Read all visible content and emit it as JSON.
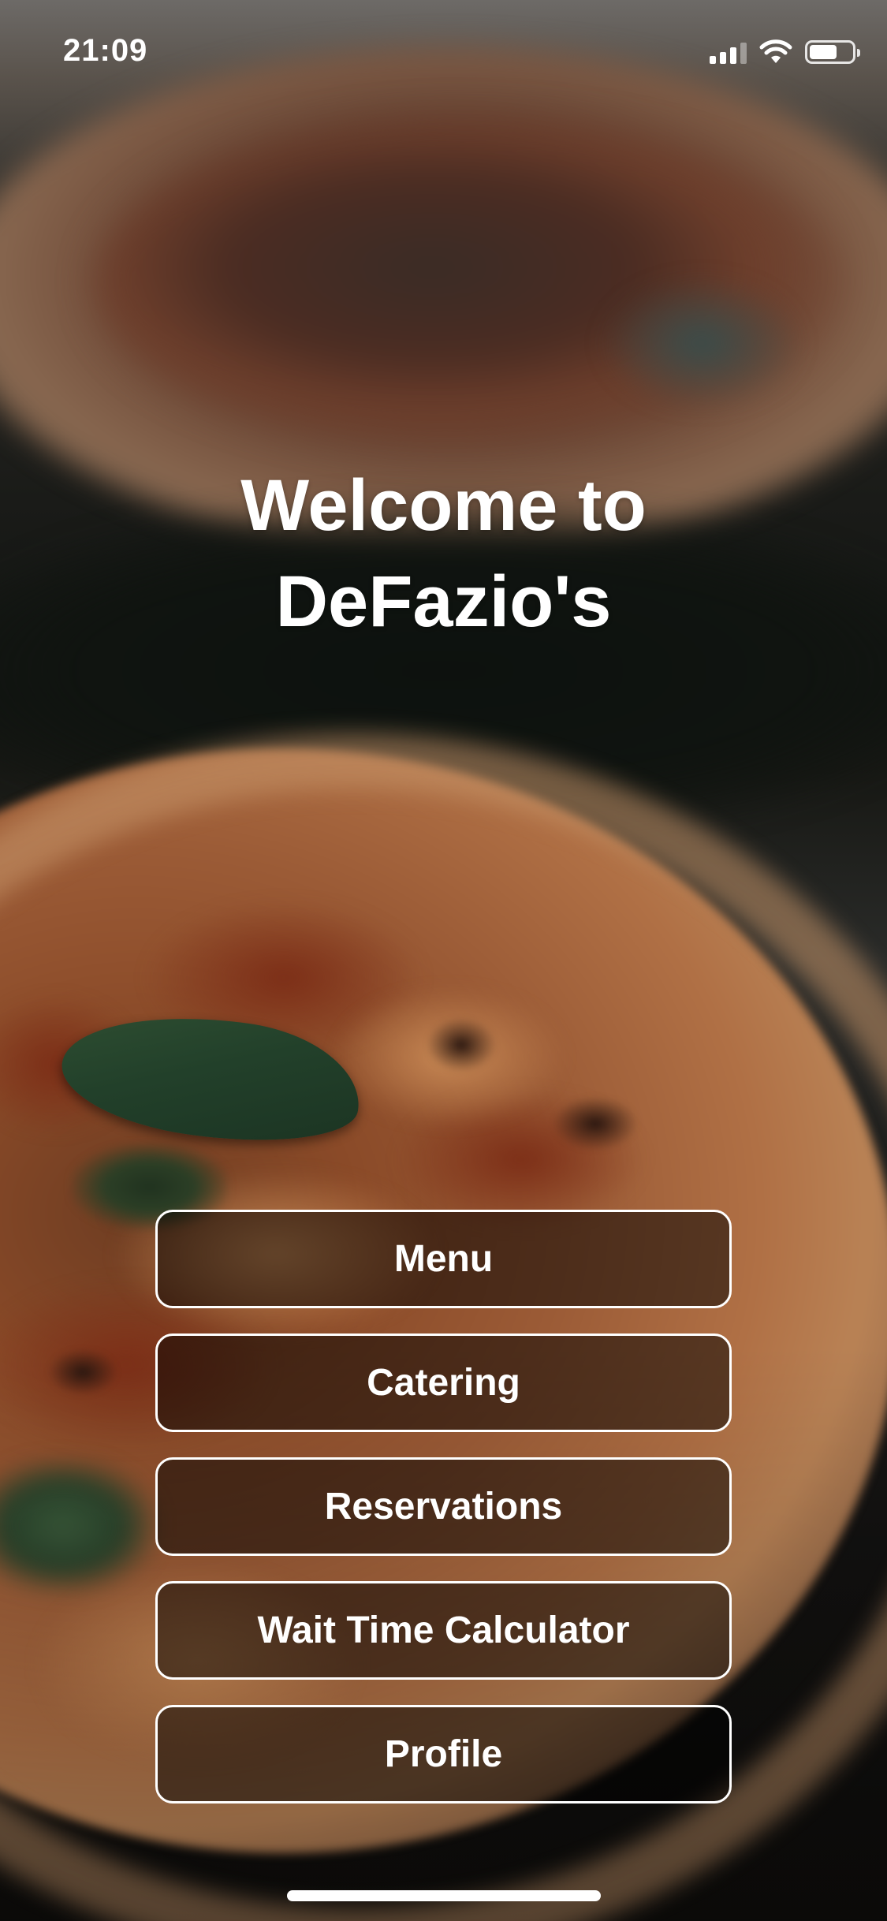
{
  "status_bar": {
    "time": "21:09",
    "signal_icon": "cellular-signal-icon",
    "wifi_icon": "wifi-icon",
    "battery_icon": "battery-icon",
    "battery_level": 0.65
  },
  "welcome": {
    "line1": "Welcome to",
    "line2": "DeFazio's"
  },
  "nav": {
    "buttons": [
      {
        "label": "Menu"
      },
      {
        "label": "Catering"
      },
      {
        "label": "Reservations"
      },
      {
        "label": "Wait Time Calculator"
      },
      {
        "label": "Profile"
      }
    ]
  },
  "colors": {
    "text": "#ffffff",
    "button_border": "#ffffff",
    "button_background": "rgba(0,0,0,0.5)"
  }
}
